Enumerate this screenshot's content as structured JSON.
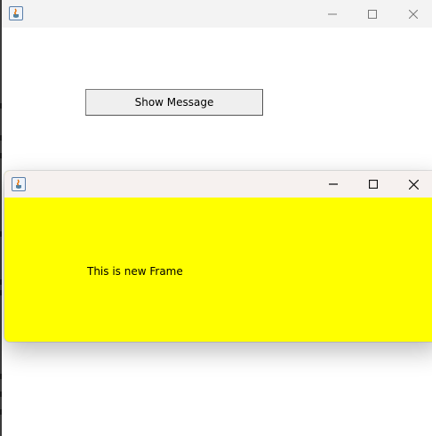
{
  "main_window": {
    "titlebar": {
      "icon": "java-cup-icon",
      "controls": [
        "minimize-icon",
        "maximize-icon",
        "close-icon"
      ]
    },
    "show_button_label": "Show Message"
  },
  "child_window": {
    "background_color": "#ffff00",
    "titlebar": {
      "icon": "java-cup-icon",
      "controls": [
        "minimize-icon",
        "maximize-icon",
        "close-icon"
      ]
    },
    "message_text": "This is new Frame"
  }
}
